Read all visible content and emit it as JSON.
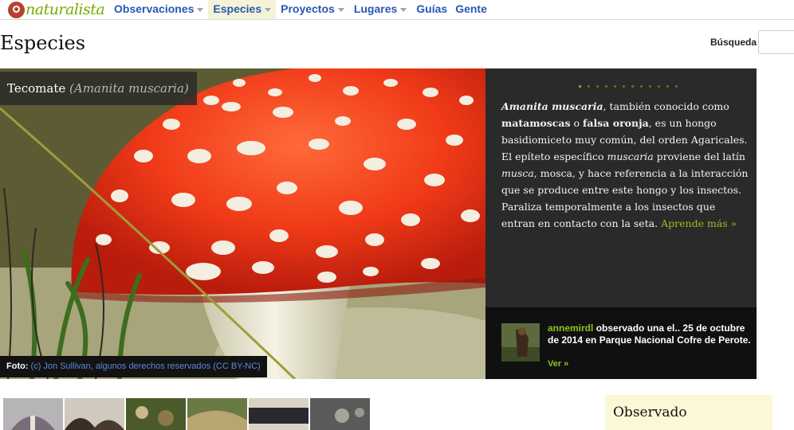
{
  "app": {
    "logo_text": "naturalista"
  },
  "nav": {
    "items": [
      {
        "label": "Observaciones",
        "has_caret": true,
        "active": false
      },
      {
        "label": "Especies",
        "has_caret": true,
        "active": true
      },
      {
        "label": "Proyectos",
        "has_caret": true,
        "active": false
      },
      {
        "label": "Lugares",
        "has_caret": true,
        "active": false
      },
      {
        "label": "Guías",
        "has_caret": false,
        "active": false
      },
      {
        "label": "Gente",
        "has_caret": false,
        "active": false
      }
    ]
  },
  "page": {
    "title": "Especies"
  },
  "search": {
    "label": "Búsqueda",
    "placeholder": ""
  },
  "featured": {
    "common_name": "Tecomate",
    "scientific_name": "(Amanita muscaria)",
    "photo_credit_label": "Foto:",
    "photo_credit_text": "(c) Jon Sullivan, algunos derechos reservados (CC BY-NC)",
    "carousel": {
      "count": 12,
      "active_index": 0
    },
    "description": {
      "lead_name": "Amanita muscaria",
      "part1": ", también conocido como ",
      "alias1": "matamoscas",
      "part2": " o ",
      "alias2": "falsa oronja",
      "part3": ", es un hongo basidiomiceto muy común, del orden Agaricales. El epíteto específico ",
      "epithet": "muscaria",
      "part4": " proviene del latín ",
      "latin_word": "musca",
      "part5": ", mosca, y hace referencia a la interacción que se produce entre este hongo y los insectos. Paraliza temporalmente a los insectos que entran en contacto con la seta. ",
      "learn_more": "Aprende más »"
    },
    "observation": {
      "user": "annemirdl",
      "text": " observado una el.. 25 de octubre de 2014 en Parque Nacional Cofre de Perote.",
      "link": "Ver »"
    }
  },
  "bottom": {
    "thumbnails": [
      "thumb-1",
      "thumb-2",
      "thumb-3",
      "thumb-4",
      "thumb-5",
      "thumb-6"
    ],
    "observed_title": "Observado"
  },
  "colors": {
    "nav_link": "#2a58ad",
    "active_tab_bg": "#f4f3d8",
    "accent_green": "#8fc21f",
    "brand_red": "#b9412f",
    "panel_bg": "#2a2a2a"
  }
}
